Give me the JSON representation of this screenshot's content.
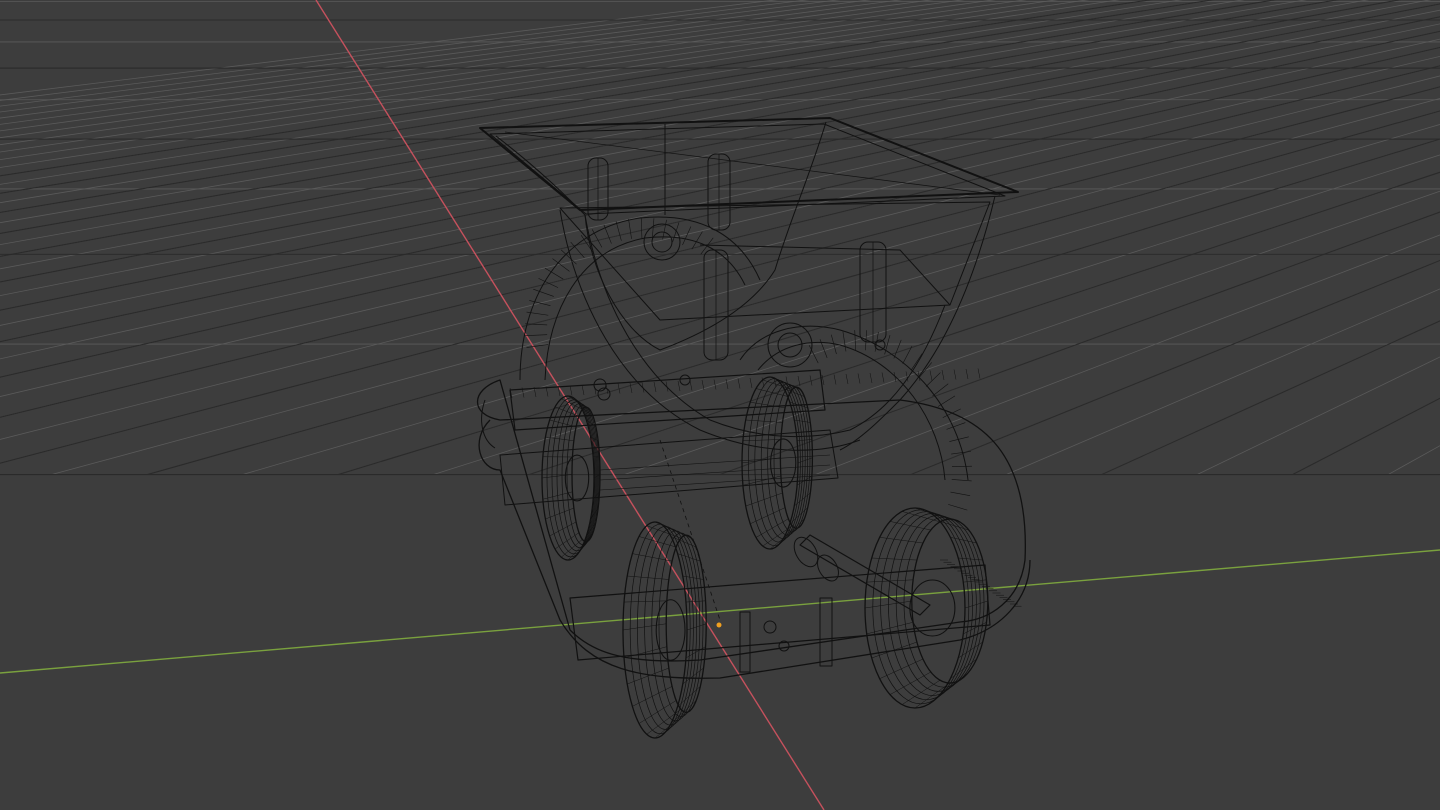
{
  "viewport": {
    "mode": "wireframe",
    "shading": "wireframe",
    "background_color": "#3d3d3d",
    "grid_color": "#5a5a5a",
    "grid_unit_color": "#505050",
    "x_axis_color": "#c5515d",
    "y_axis_color": "#7aa13e",
    "wire_color": "#111111",
    "origin_color": "#f0a020"
  },
  "scene_object": {
    "name": "mine cart",
    "selected": false
  }
}
